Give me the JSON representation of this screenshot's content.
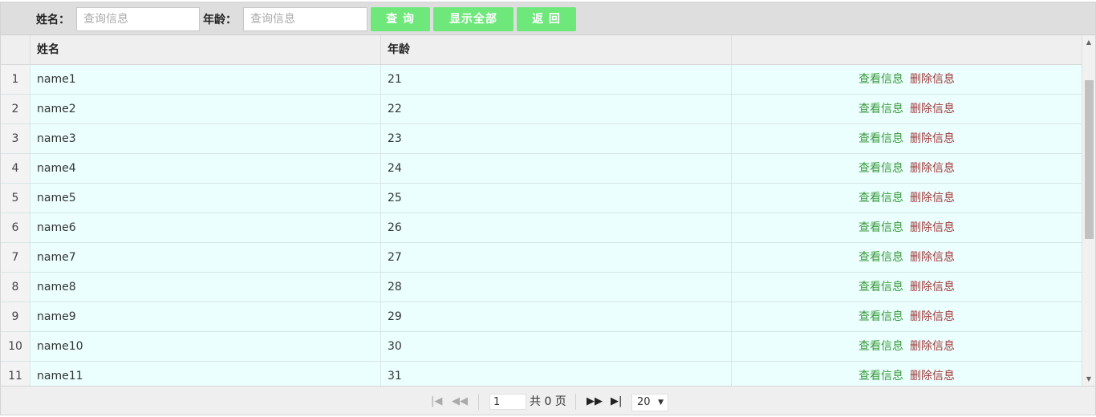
{
  "toolbar": {
    "name_label": "姓名：",
    "name_placeholder": "查询信息",
    "age_label": "年龄：",
    "age_placeholder": "查询信息",
    "query_button": "查 询",
    "show_all_button": "显示全部",
    "back_button": "返 回"
  },
  "table": {
    "columns": [
      "姓名",
      "年龄",
      ""
    ],
    "rows": [
      {
        "num": "1",
        "name": "name1",
        "age": "21"
      },
      {
        "num": "2",
        "name": "name2",
        "age": "22"
      },
      {
        "num": "3",
        "name": "name3",
        "age": "23"
      },
      {
        "num": "4",
        "name": "name4",
        "age": "24"
      },
      {
        "num": "5",
        "name": "name5",
        "age": "25"
      },
      {
        "num": "6",
        "name": "name6",
        "age": "26"
      },
      {
        "num": "7",
        "name": "name7",
        "age": "27"
      },
      {
        "num": "8",
        "name": "name8",
        "age": "28"
      },
      {
        "num": "9",
        "name": "name9",
        "age": "29"
      },
      {
        "num": "10",
        "name": "name10",
        "age": "30"
      },
      {
        "num": "11",
        "name": "name11",
        "age": "31"
      }
    ],
    "view_action": "查看信息",
    "delete_action": "删除信息"
  },
  "pager": {
    "page_value": "1",
    "total_text": "共 0 页",
    "page_size": "20"
  },
  "colors": {
    "button_bg": "#6ee77b",
    "row_bg": "#ebfffe",
    "view_link": "#3a9a3a",
    "delete_link": "#a23a3a"
  }
}
